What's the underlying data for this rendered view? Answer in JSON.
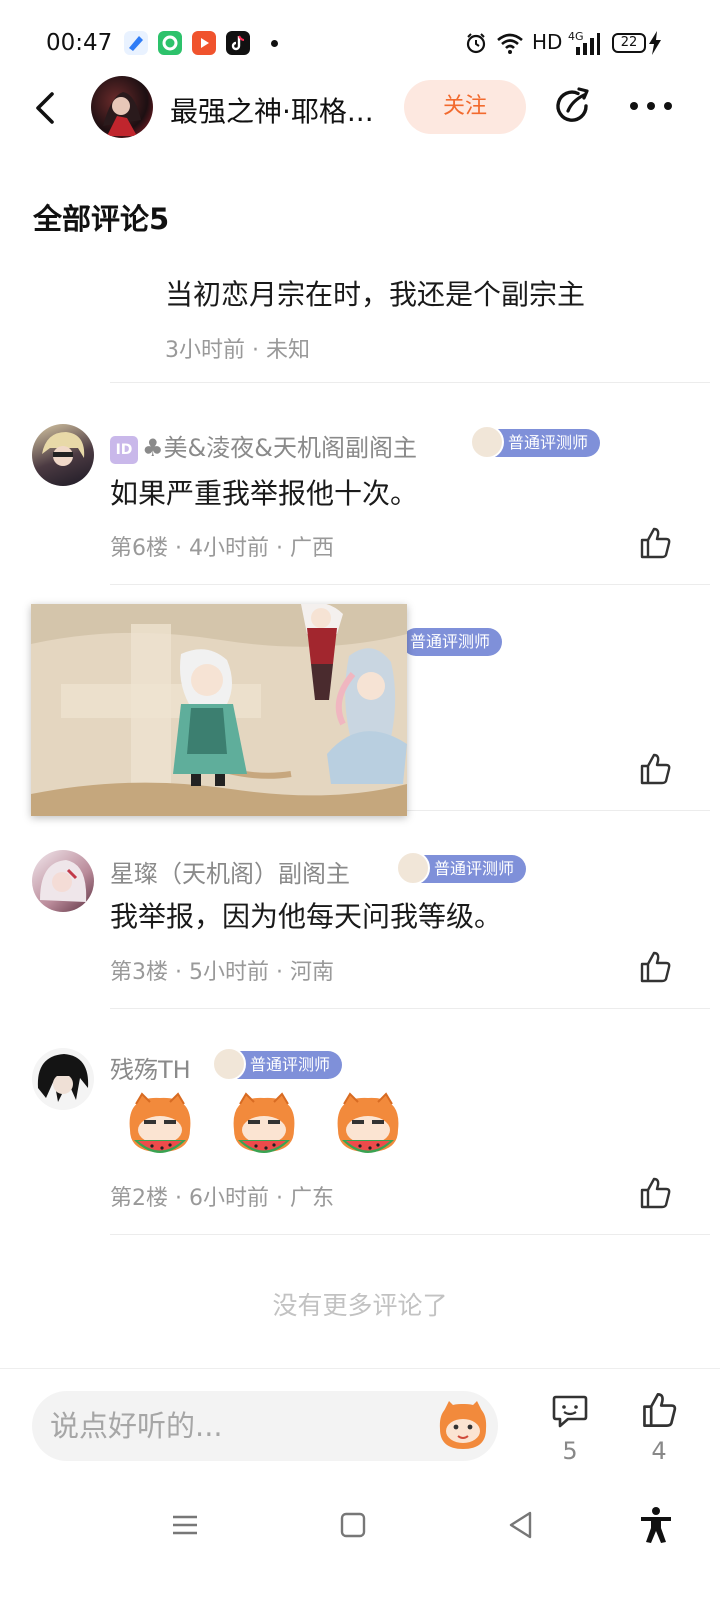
{
  "status_bar": {
    "time": "00:47",
    "network": "HD",
    "signal": "4G",
    "battery": "22",
    "icons": [
      "blue-app-icon",
      "green-app-icon",
      "video-app-icon",
      "tiktok-icon",
      "alarm-icon",
      "wifi-icon",
      "signal-icon",
      "battery-icon",
      "charging-icon"
    ]
  },
  "header": {
    "author_name": "最强之神·耶格...",
    "follow_label": "关注",
    "icons": [
      "back-icon",
      "share-icon",
      "more-icon"
    ]
  },
  "section": {
    "title": "全部评论5"
  },
  "comments": [
    {
      "text": "当初恋月宗在时，我还是个副宗主",
      "meta": "3小时前 · 未知"
    },
    {
      "id_icon": "ID",
      "username": "♣美&淩夜&天机阁副阁主",
      "badge": "普通评测师",
      "text": "如果严重我举报他十次。",
      "meta": "第6楼 · 4小时前 · 广西"
    },
    {
      "badge": "普通评测师"
    },
    {
      "username": "星璨（天机阁）副阁主",
      "badge": "普通评测师",
      "text": "我举报，因为他每天问我等级。",
      "meta": "第3楼 · 5小时前 · 河南"
    },
    {
      "username": "残殇TH",
      "badge": "普通评测师",
      "sticker": "watermelon-cat-sticker",
      "meta": "第2楼 · 6小时前 · 广东"
    }
  ],
  "no_more_text": "没有更多评论了",
  "bottom_bar": {
    "input_placeholder": "说点好听的...",
    "comment_count": "5",
    "like_count": "4"
  },
  "colors": {
    "accent": "#f26a2e",
    "follow_bg": "#fde8e0",
    "badge_bg": "#7f90d9",
    "meta_text": "#999999"
  }
}
